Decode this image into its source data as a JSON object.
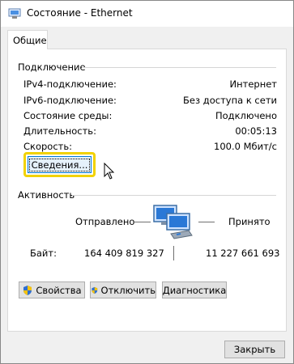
{
  "window": {
    "title": "Состояние - Ethernet"
  },
  "tabs": [
    {
      "label": "Общие"
    }
  ],
  "connection": {
    "title": "Подключение",
    "rows": [
      {
        "label": "IPv4-подключение:",
        "value": "Интернет"
      },
      {
        "label": "IPv6-подключение:",
        "value": "Без доступа к сети"
      },
      {
        "label": "Состояние среды:",
        "value": "Подключено"
      },
      {
        "label": "Длительность:",
        "value": "00:05:13"
      },
      {
        "label": "Скорость:",
        "value": "100.0 Мбит/с"
      }
    ],
    "details_button": "Сведения..."
  },
  "activity": {
    "title": "Активность",
    "sent_label": "Отправлено",
    "received_label": "Принято",
    "bytes_label": "Байт:",
    "sent_bytes": "164 409 819 327",
    "received_bytes": "11 227 661 693"
  },
  "actions": {
    "properties": "Свойства",
    "disable": "Отключить",
    "diagnose": "Диагностика"
  },
  "close_button": "Закрыть",
  "colors": {
    "highlight": "#f2d200",
    "focus": "#0078d7"
  },
  "icons": {
    "title": "network-adapter-icon",
    "shield": "uac-shield-icon",
    "network": "network-computers-icon",
    "cursor": "mouse-pointer-icon"
  }
}
